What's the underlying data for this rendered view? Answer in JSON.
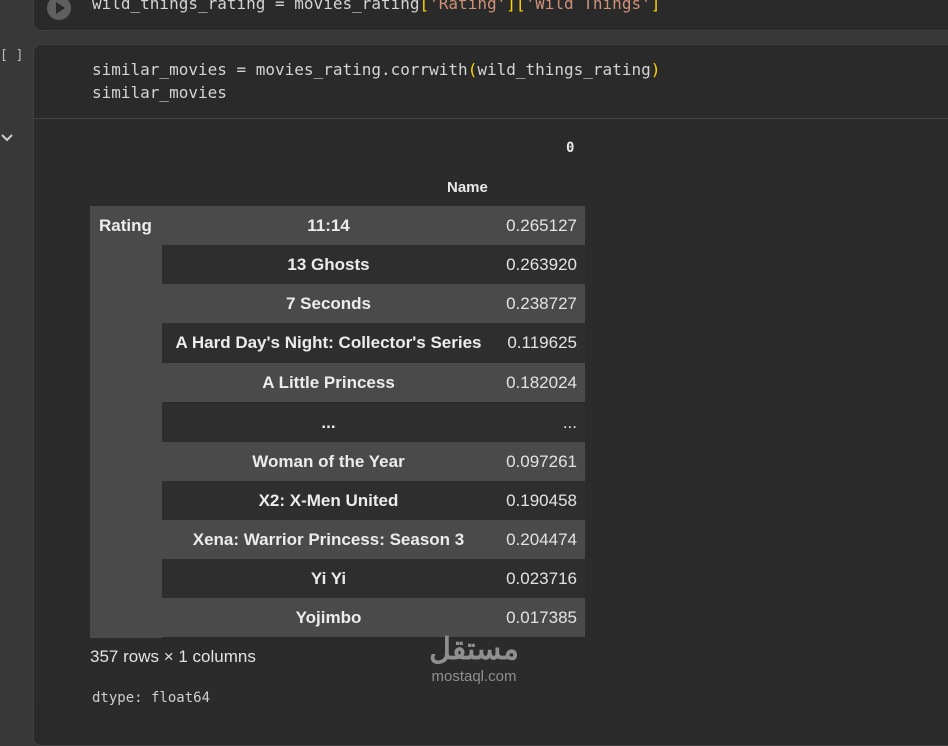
{
  "top_cell": {
    "code_prefix": "wild_things_rating = movies_rating",
    "code_open1": "[",
    "code_str1": "'Rating'",
    "code_mid": "][",
    "code_str2": "'Wild Things'",
    "code_close": "]"
  },
  "cell": {
    "bracket": "[ ]",
    "line1_a": "similar_movies = movies_rating.corrwith",
    "line1_paren_open": "(",
    "line1_arg": "wild_things_rating",
    "line1_paren_close": ")",
    "line2": "similar_movies"
  },
  "output": {
    "col_header": "0",
    "index_name": "Name",
    "index_level0": "Rating",
    "rows": [
      {
        "name": "11:14",
        "value": "0.265127"
      },
      {
        "name": "13 Ghosts",
        "value": "0.263920"
      },
      {
        "name": "7 Seconds",
        "value": "0.238727"
      },
      {
        "name": "A Hard Day's Night: Collector's Series",
        "value": "0.119625"
      },
      {
        "name": "A Little Princess",
        "value": "0.182024"
      },
      {
        "name": "...",
        "value": "..."
      },
      {
        "name": "Woman of the Year",
        "value": "0.097261"
      },
      {
        "name": "X2: X-Men United",
        "value": "0.190458"
      },
      {
        "name": "Xena: Warrior Princess: Season 3",
        "value": "0.204474"
      },
      {
        "name": "Yi Yi",
        "value": "0.023716"
      },
      {
        "name": "Yojimbo",
        "value": "0.017385"
      }
    ],
    "summary": "357 rows × 1 columns"
  },
  "watermark": {
    "arabic": "مستقل",
    "latin": "mostaql.com"
  },
  "bottom": {
    "code": "dtype: float64"
  },
  "colors": {
    "background": "#383838",
    "cell_bg": "#2a2a2a",
    "row_odd": "#4a4a4a",
    "row_even": "#2e2e2e",
    "string": "#ce9178",
    "paren": "#ffd700"
  }
}
